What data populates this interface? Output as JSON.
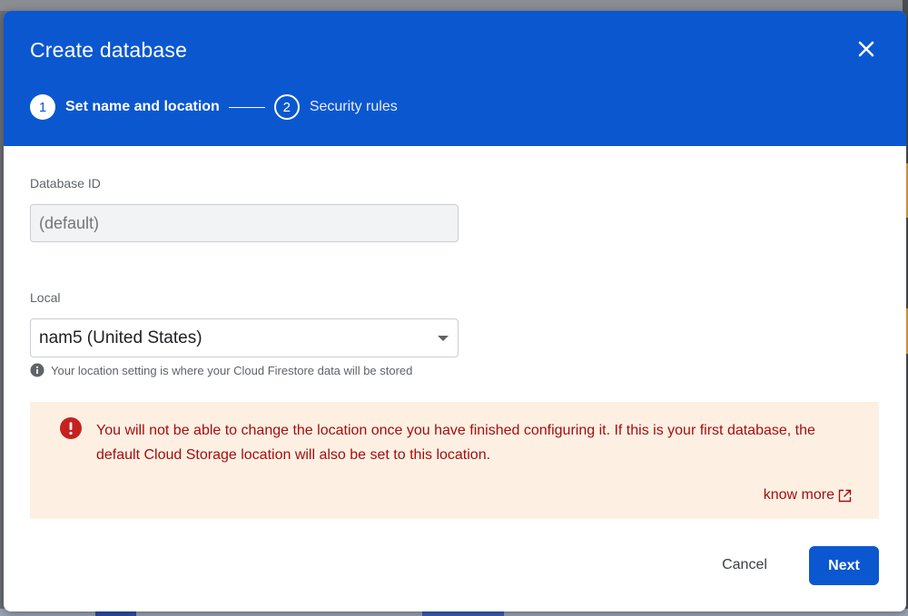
{
  "dialog": {
    "title": "Create database",
    "steps": [
      {
        "number": "1",
        "label": "Set name and location",
        "state": "active"
      },
      {
        "number": "2",
        "label": "Security rules",
        "state": "inactive"
      }
    ]
  },
  "form": {
    "database_id": {
      "label": "Database ID",
      "placeholder": "(default)"
    },
    "location": {
      "label": "Local",
      "selected": "nam5 (United States)",
      "hint": "Your location setting is where your Cloud Firestore data will be stored"
    }
  },
  "warning": {
    "message": "You will not be able to change the location once you have finished configuring it. If this is your first database, the default Cloud Storage location will also be set to this location.",
    "link": "know more"
  },
  "actions": {
    "cancel": "Cancel",
    "next": "Next"
  },
  "icons": {
    "close": "close-icon",
    "info": "info-icon",
    "error": "error-icon",
    "dropdown": "dropdown-arrow-icon",
    "external": "external-link-icon"
  },
  "colors": {
    "primary": "#0b57d0",
    "warning_bg": "#fdf0e3",
    "warning_text": "#a50e0e"
  }
}
